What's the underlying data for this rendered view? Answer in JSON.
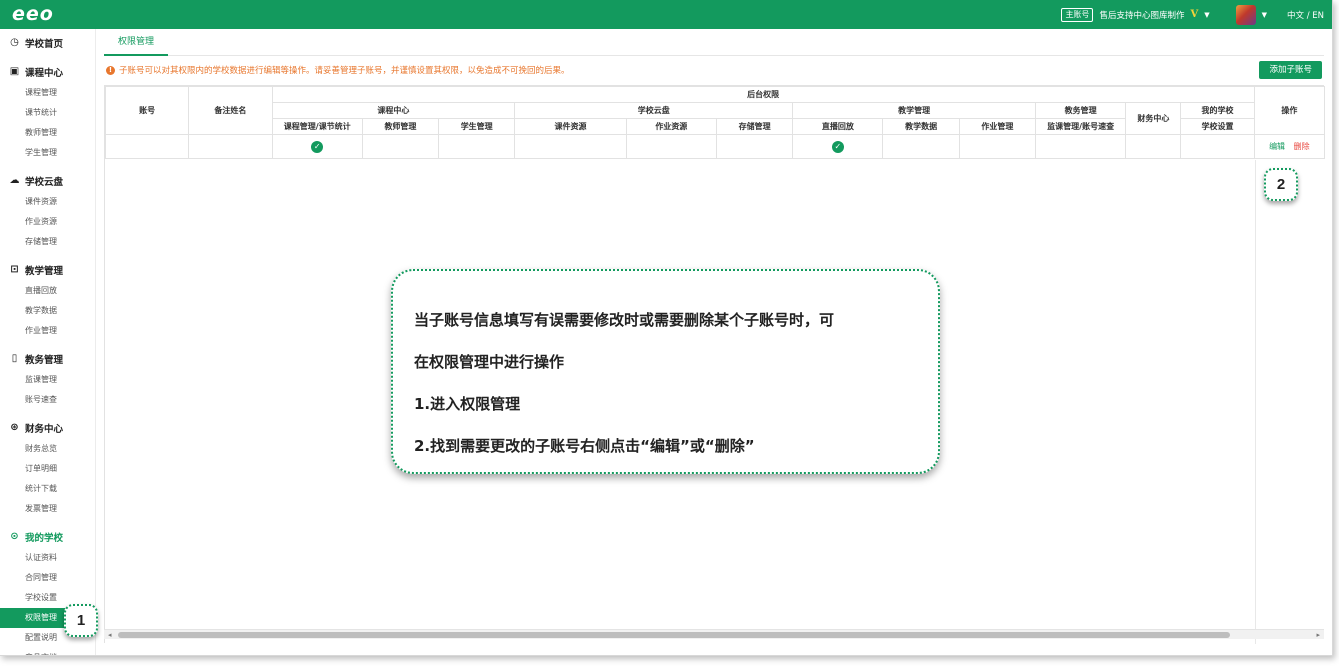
{
  "topbar": {
    "logo": "eeo",
    "badge": "主账号",
    "account_name": "售后支持中心图库制作",
    "vip_mark": "V",
    "lang": "中文 / EN"
  },
  "sidebar": {
    "groups": [
      {
        "label": "学校首页",
        "icon": "clock-icon",
        "items": []
      },
      {
        "label": "课程中心",
        "icon": "calendar-icon",
        "items": [
          "课程管理",
          "课节统计",
          "教师管理",
          "学生管理"
        ]
      },
      {
        "label": "学校云盘",
        "icon": "cloud-icon",
        "items": [
          "课件资源",
          "作业资源",
          "存储管理"
        ]
      },
      {
        "label": "教学管理",
        "icon": "board-icon",
        "items": [
          "直播回放",
          "教学数据",
          "作业管理"
        ]
      },
      {
        "label": "教务管理",
        "icon": "doc-icon",
        "items": [
          "监课管理",
          "账号速查"
        ]
      },
      {
        "label": "财务中心",
        "icon": "yen-icon",
        "items": [
          "财务总览",
          "订单明细",
          "统计下载",
          "发票管理"
        ]
      },
      {
        "label": "我的学校",
        "icon": "school-icon",
        "items": [
          "认证资料",
          "合同管理",
          "学校设置",
          "权限管理",
          "配置说明",
          "产品文档"
        ]
      }
    ],
    "active_item": "权限管理"
  },
  "main": {
    "tab": "权限管理",
    "warning": "子账号可以对其权限内的学校数据进行编辑等操作。请妥善管理子账号，并谨慎设置其权限，以免造成不可挽回的后果。",
    "add_button": "添加子账号"
  },
  "table": {
    "account": "账号",
    "remark": "备注姓名",
    "backend": "后台权限",
    "operation": "操作",
    "groups": {
      "course": "课程中心",
      "cloud": "学校云盘",
      "teaching": "教学管理",
      "affairs": "教务管理",
      "finance": "财务中心",
      "school": "我的学校"
    },
    "subheaders": {
      "course_stats": "课程管理/课节统计",
      "teacher": "教师管理",
      "student": "学生管理",
      "courseware": "课件资源",
      "homework_res": "作业资源",
      "storage": "存储管理",
      "replay": "直播回放",
      "teach_data": "教学数据",
      "homework_mgmt": "作业管理",
      "monitor": "监课管理/账号速查",
      "school_settings": "学校设置"
    },
    "row": {
      "account": "",
      "remark": "",
      "checked": [
        "课程管理/课节统计",
        "直播回放"
      ],
      "edit": "编辑",
      "delete": "删除"
    }
  },
  "callout": {
    "lines": [
      "当子账号信息填写有误需要修改时或需要删除某个子账号时，可",
      "在权限管理中进行操作",
      "1.进入权限管理",
      "2.找到需要更改的子账号右侧点击“编辑”或“删除”"
    ],
    "step1": "1",
    "step2": "2"
  }
}
